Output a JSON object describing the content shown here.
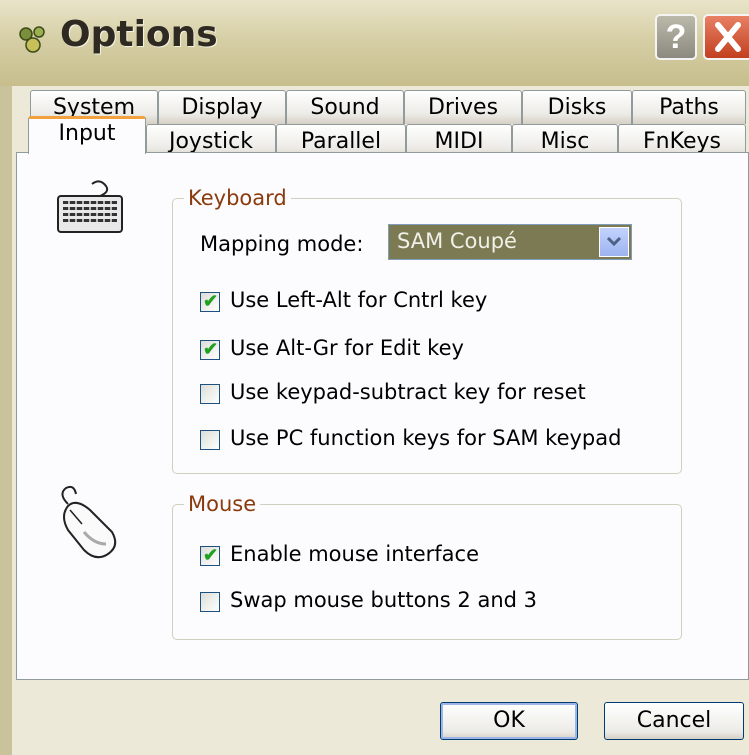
{
  "window": {
    "title": "Options",
    "help_glyph": "?"
  },
  "tabs_row1": [
    {
      "label": "System"
    },
    {
      "label": "Display"
    },
    {
      "label": "Sound"
    },
    {
      "label": "Drives"
    },
    {
      "label": "Disks"
    },
    {
      "label": "Paths"
    }
  ],
  "tabs_row2": [
    {
      "label": "Input"
    },
    {
      "label": "Joystick"
    },
    {
      "label": "Parallel"
    },
    {
      "label": "MIDI"
    },
    {
      "label": "Misc"
    },
    {
      "label": "FnKeys"
    }
  ],
  "active_tab": "Input",
  "keyboard": {
    "legend": "Keyboard",
    "mapping_label": "Mapping mode:",
    "mapping_value": "SAM Coupé",
    "options": [
      {
        "label": "Use Left-Alt for Cntrl key",
        "checked": true
      },
      {
        "label": "Use Alt-Gr for Edit key",
        "checked": true
      },
      {
        "label": "Use keypad-subtract key for reset",
        "checked": false
      },
      {
        "label": "Use PC function keys for SAM keypad",
        "checked": false
      }
    ]
  },
  "mouse": {
    "legend": "Mouse",
    "options": [
      {
        "label": "Enable mouse interface",
        "checked": true
      },
      {
        "label": "Swap mouse buttons 2 and 3",
        "checked": false
      }
    ]
  },
  "buttons": {
    "ok": "OK",
    "cancel": "Cancel"
  },
  "colors": {
    "accent": "#F3A13F",
    "legend": "#8A3A0C",
    "check": "#21A121"
  },
  "icons": {
    "app": "sam-app-icon",
    "keyboard": "keyboard-icon",
    "mouse": "mouse-icon"
  }
}
